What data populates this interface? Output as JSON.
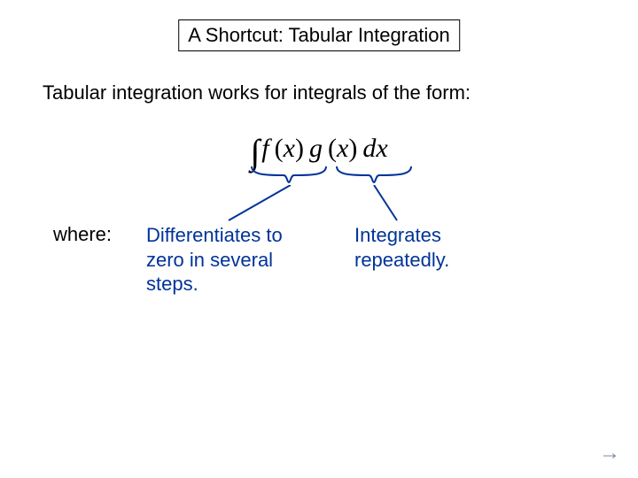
{
  "title": "A Shortcut:  Tabular Integration",
  "intro": "Tabular integration works for integrals of the form:",
  "formula": {
    "f": "f",
    "x1": "x",
    "g": "g",
    "x2": "x",
    "dx": "dx"
  },
  "where_label": "where:",
  "note_left": "Differentiates to zero in several steps.",
  "note_right": "Integrates repeatedly.",
  "arrow": "→",
  "colors": {
    "accent": "#003399",
    "arrow": "#7a8aa0"
  }
}
